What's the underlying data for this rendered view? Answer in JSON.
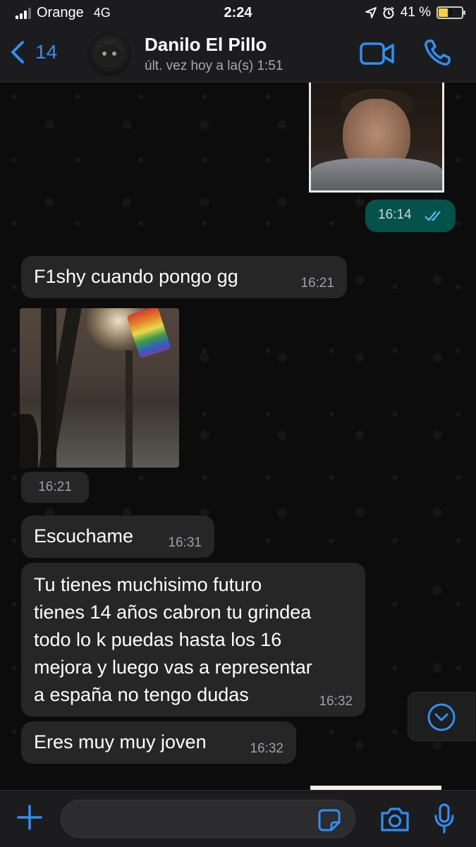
{
  "status_bar": {
    "carrier": "Orange",
    "network": "4G",
    "time": "2:24",
    "battery_percent": "41 %",
    "battery_level": 0.41
  },
  "header": {
    "back_count": "14",
    "contact_name": "Danilo El Pillo",
    "last_seen": "últ. vez hoy a la(s) 1:51"
  },
  "messages": [
    {
      "kind": "image",
      "direction": "outgoing",
      "time": "16:14",
      "status": "read"
    },
    {
      "kind": "text",
      "direction": "incoming",
      "text": "F1shy cuando pongo gg",
      "time": "16:21"
    },
    {
      "kind": "video",
      "direction": "incoming",
      "time": "16:21"
    },
    {
      "kind": "text",
      "direction": "incoming",
      "text": "Escuchame",
      "time": "16:31"
    },
    {
      "kind": "text",
      "direction": "incoming",
      "lines": [
        "Tu tienes muchisimo futuro",
        "tienes 14 años cabron tu grindea",
        "todo lo k puedas hasta los 16",
        "mejora y luego vas a representar",
        "a españa no tengo dudas"
      ],
      "time": "16:32"
    },
    {
      "kind": "text",
      "direction": "incoming",
      "text": "Eres muy muy joven",
      "time": "16:32"
    }
  ],
  "colors": {
    "accent": "#2f8ff5",
    "outgoing_bubble": "#04524a",
    "incoming_bubble": "#262626",
    "read_ticks": "#53bdeb"
  },
  "icons": [
    "back-chevron-icon",
    "video-call-icon",
    "phone-icon",
    "double-check-icon",
    "chevron-down-icon",
    "plus-icon",
    "sticker-icon",
    "camera-icon",
    "microphone-icon"
  ]
}
